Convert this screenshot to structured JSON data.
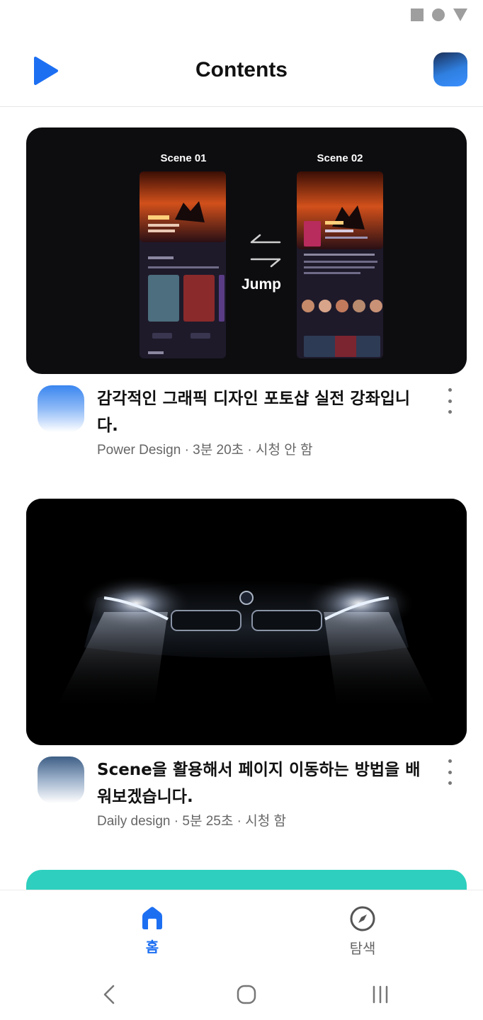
{
  "header": {
    "title": "Contents"
  },
  "feed": [
    {
      "thumbnail": {
        "scene_left": "Scene 01",
        "scene_right": "Scene 02",
        "action": "Jump"
      },
      "title": "감각적인 그래픽 디자인 포토샵 실전 강좌입니다.",
      "channel": "Power Design",
      "duration": "3분 20초",
      "status": "시청 안 함"
    },
    {
      "title": "Scene을 활용해서 페이지 이동하는 방법을 배워보겠습니다.",
      "channel": "Daily design",
      "duration": "5분 25초",
      "status": "시청 함"
    }
  ],
  "bottom_nav": {
    "home_label": "홈",
    "explore_label": "탐색"
  },
  "colors": {
    "accent": "#1d6ff2",
    "teal_card": "#2ecfbe"
  }
}
